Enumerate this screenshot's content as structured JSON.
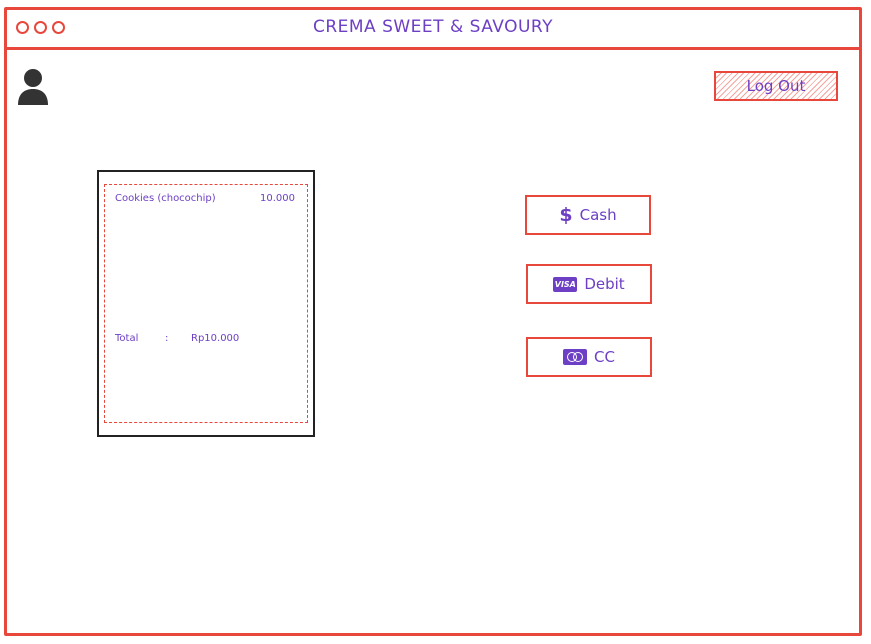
{
  "window": {
    "title": "CREMA SWEET & SAVOURY"
  },
  "header": {
    "logout_label": "Log Out"
  },
  "receipt": {
    "items": [
      {
        "name": "Cookies (chocochip)",
        "price": "10.000"
      }
    ],
    "total_label": "Total",
    "total_separator": ":",
    "total_value": "Rp10.000"
  },
  "payment": {
    "cash_label": "Cash",
    "debit_label": "Debit",
    "cc_label": "CC",
    "debit_card_text": "VISA"
  },
  "icons": {
    "user": "user-icon",
    "cash": "dollar-icon",
    "debit": "visa-card-icon",
    "cc": "mastercard-icon"
  },
  "colors": {
    "accent_red": "#e8473b",
    "text_purple": "#6c3fc4"
  }
}
